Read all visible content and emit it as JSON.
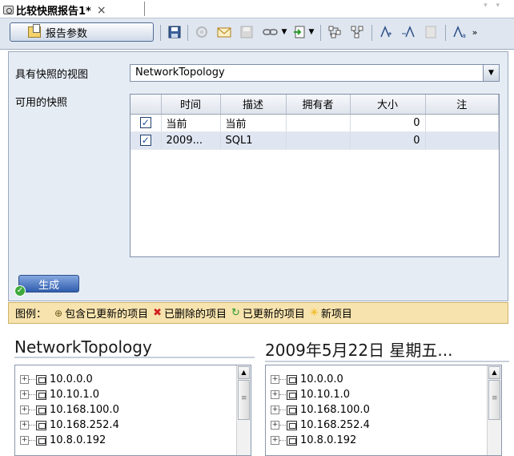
{
  "tab": {
    "title": "比较快照报告1*",
    "close": "×"
  },
  "toolbar": {
    "report_params_label": "报告参数",
    "icons": [
      "save-icon",
      "settings-icon",
      "email-icon",
      "save-disabled-icon",
      "link-icon",
      "export-icon",
      "expand-all-icon",
      "collapse-all-icon",
      "sort-asc-icon",
      "sort-desc-icon",
      "page-icon",
      "font-size-icon",
      "overflow-icon"
    ]
  },
  "form": {
    "view_label": "具有快照的视图",
    "view_value": "NetworkTopology",
    "snapshots_label": "可用的快照"
  },
  "table": {
    "columns": [
      "时间",
      "描述",
      "拥有者",
      "大小",
      "注"
    ],
    "rows": [
      {
        "checked": true,
        "time": "当前",
        "desc": "当前",
        "owner": "",
        "size": "0",
        "note": ""
      },
      {
        "checked": true,
        "time": "2009...",
        "desc": "SQL1",
        "owner": "",
        "size": "0",
        "note": ""
      }
    ]
  },
  "generate_label": "生成",
  "legend": {
    "title": "图例：",
    "items": [
      {
        "label": "包含已更新的项目",
        "icon": "contains-updated-icon"
      },
      {
        "label": "已删除的项目",
        "icon": "deleted-icon"
      },
      {
        "label": "已更新的项目",
        "icon": "updated-icon"
      },
      {
        "label": "新项目",
        "icon": "new-icon"
      }
    ]
  },
  "left_pane": {
    "title": "NetworkTopology",
    "nodes": [
      "10.0.0.0",
      "10.10.1.0",
      "10.168.100.0",
      "10.168.252.4",
      "10.8.0.192"
    ]
  },
  "right_pane": {
    "title": "2009年5月22日 星期五...",
    "nodes": [
      "10.0.0.0",
      "10.10.1.0",
      "10.168.100.0",
      "10.168.252.4",
      "10.8.0.192"
    ]
  }
}
